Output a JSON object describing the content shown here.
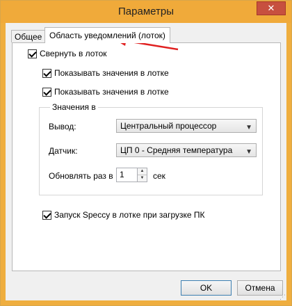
{
  "window": {
    "title": "Параметры",
    "close_symbol": "✕"
  },
  "tabs": [
    {
      "label": "Общее",
      "selected": false
    },
    {
      "label": "Область уведомлений (лоток)",
      "selected": true
    }
  ],
  "options": {
    "minimize_to_tray": {
      "label": "Свернуть в лоток",
      "checked": true
    },
    "show_values_1": {
      "label": "Показывать значения в лотке",
      "checked": true
    },
    "show_values_2": {
      "label": "Показывать значения в лотке",
      "checked": true
    },
    "startup_tray": {
      "label": "Запуск Speccy в лотке при загрузке ПК",
      "checked": true
    }
  },
  "values_group": {
    "legend": "Значения в",
    "output": {
      "label": "Вывод:",
      "selected": "Центральный процессор"
    },
    "sensor": {
      "label": "Датчик:",
      "selected": "ЦП 0 - Средняя температура"
    },
    "refresh": {
      "label": "Обновлять раз в",
      "value": "1",
      "unit": "сек"
    }
  },
  "buttons": {
    "ok": "OK",
    "cancel": "Отмена"
  },
  "colors": {
    "titlebar": "#f0aa3a",
    "close_button": "#c7503f",
    "annotation_arrow": "#e02020"
  }
}
